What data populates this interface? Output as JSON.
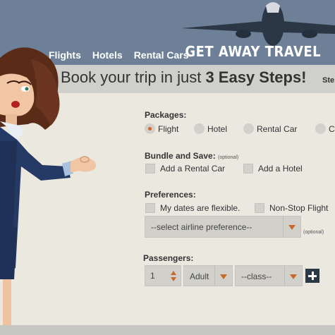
{
  "header": {
    "nav": [
      "Flights",
      "Hotels",
      "Rental Cars"
    ],
    "brand": "GET AWAY TRAVEL"
  },
  "banner": {
    "text_prefix": "Book your trip in just ",
    "text_emphasis": "3 Easy Steps!",
    "steps_cut": "Ste"
  },
  "packages": {
    "title": "Packages:",
    "options": [
      {
        "label": "Flight",
        "selected": true
      },
      {
        "label": "Hotel",
        "selected": false
      },
      {
        "label": "Rental Car",
        "selected": false
      },
      {
        "label": "C",
        "selected": false
      }
    ]
  },
  "bundle": {
    "title": "Bundle and Save:",
    "optional": "(optional)",
    "options": [
      "Add a Rental Car",
      "Add a Hotel"
    ]
  },
  "preferences": {
    "title": "Preferences:",
    "options": [
      "My dates are flexible.",
      "Non-Stop Flight"
    ],
    "airline_select": "--select airline preference--",
    "optional": "(optional)"
  },
  "passengers": {
    "title": "Passengers:",
    "count": "1",
    "type": "Adult",
    "class": "--class--"
  },
  "colors": {
    "header_bg": "#6d8098",
    "accent": "#d2652a",
    "page_bg": "#ebe8e0"
  }
}
